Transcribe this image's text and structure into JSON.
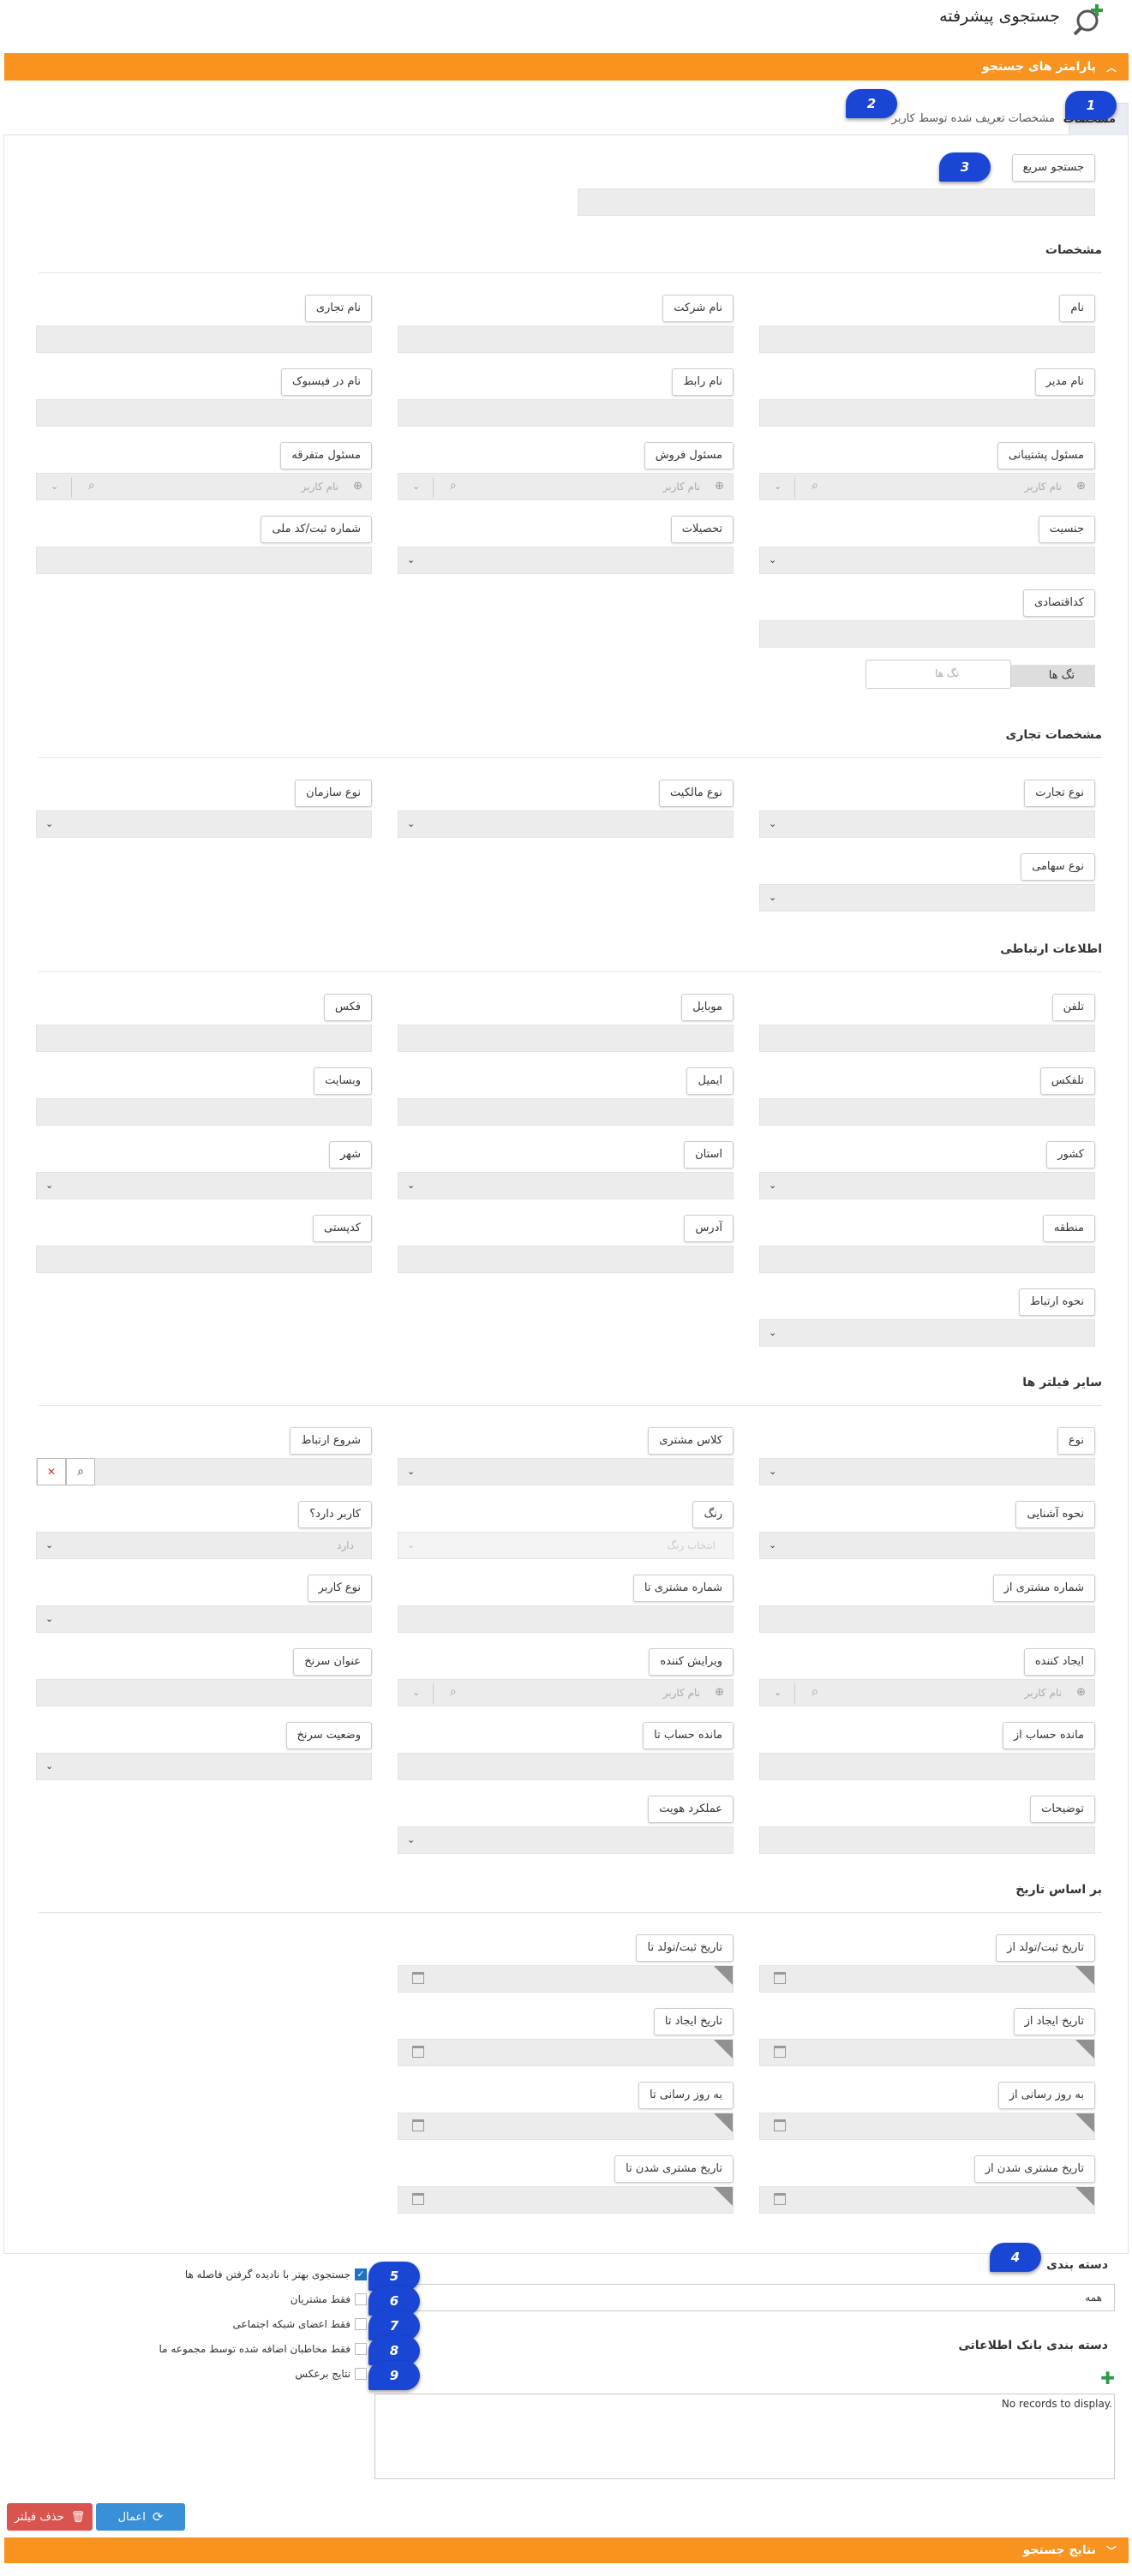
{
  "header": {
    "title": "جستجوی پیشرفته",
    "icon": "search-plus-icon"
  },
  "params_bar": {
    "label": "پارامتر های جستجو"
  },
  "tabs": [
    {
      "label": "مشخصات"
    },
    {
      "label": "مشخصات تعریف شده توسط کاربر"
    }
  ],
  "quick_search": {
    "label": "جستجو سریع"
  },
  "sections": {
    "specs": "مشخصات",
    "business": "مشخصات تجاری",
    "contact": "اطلاعات ارتباطی",
    "other": "سایر فیلتر ها",
    "date": "بر اساس تاریخ"
  },
  "specs": {
    "name": "نام",
    "company": "نام شرکت",
    "brand": "نام تجاری",
    "manager": "نام مدیر",
    "liaison": "نام رابط",
    "facebook": "نام در فیسبوک",
    "support": "مسئول پشتیبانی",
    "sales": "مسئول فروش",
    "misc": "مسئول متفرقه",
    "user_placeholder": "نام کاربر",
    "gender": "جنسیت",
    "education": "تحصیلات",
    "national_id": "شماره ثبت/کد ملی",
    "economic_code": "کداقتصادی",
    "tags_btn": "تگ ها",
    "tags_placeholder": "تگ ها"
  },
  "business": {
    "trade_type": "نوع تجارت",
    "ownership": "نوع مالکیت",
    "org_type": "نوع سازمان",
    "share_type": "نوع سهامی"
  },
  "contact": {
    "phone": "تلفن",
    "mobile": "موبایل",
    "fax": "فکس",
    "telex": "تلفکس",
    "email": "ایمیل",
    "website": "وبسایت",
    "country": "کشور",
    "province": "استان",
    "city": "شهر",
    "region": "منطقه",
    "address": "آدرس",
    "postal": "کدپستی",
    "method": "نحوه ارتباط"
  },
  "other": {
    "type": "نوع",
    "customer_class": "کلاس مشتری",
    "start_contact": "شروع ارتباط",
    "acquaintance": "نحوه آشنایی",
    "color": "رنگ",
    "color_placeholder": "انتخاب رنگ",
    "has_user": "کاربر دارد؟",
    "has_user_value": "دارد",
    "cust_from": "شماره مشتری از",
    "cust_to": "شماره مشتری تا",
    "user_type": "نوع کاربر",
    "creator": "ایجاد کننده",
    "editor": "ویرایش کننده",
    "lead_title": "عنوان سرنخ",
    "bal_from": "مانده حساب از",
    "bal_to": "مانده حساب تا",
    "lead_status": "وضعیت سرنخ",
    "desc": "توضیحات",
    "identity": "عملکرد هویت"
  },
  "date": {
    "reg_from": "تاریخ ثبت/تولد از",
    "reg_to": "تاریخ ثبت/تولد تا",
    "create_from": "تاریخ ایجاد از",
    "create_to": "تاریخ ایجاد تا",
    "upd_from": "به روز رسانی از",
    "upd_to": "به روز رسانی تا",
    "cust_from": "تاریخ مشتری شدن از",
    "cust_to": "تاریخ مشتری شدن تا"
  },
  "grouping": {
    "label": "دسته بندی",
    "value": "همه",
    "db_label": "دسته بندی بانک اطلاعاتی",
    "no_records": "No records to display."
  },
  "options": [
    {
      "label": "جستجوی بهتر با نادیده گرفتن فاصله ها",
      "checked": true
    },
    {
      "label": "فقط مشتریان",
      "checked": false
    },
    {
      "label": "فقط اعضای شبکه اجتماعی",
      "checked": false
    },
    {
      "label": "فقط مخاطبان اضافه شده توسط مجموعه ما",
      "checked": false
    },
    {
      "label": "نتایج برعکس",
      "checked": false
    }
  ],
  "badges": [
    "1",
    "2",
    "3",
    "4",
    "5",
    "6",
    "7",
    "8",
    "9"
  ],
  "buttons": {
    "apply": "اعمال",
    "clear": "حذف فیلتر"
  },
  "results_bar": {
    "label": "نتایج جستجو"
  },
  "colors": {
    "orange": "#f7931e",
    "blue": "#1a46d6",
    "apply": "#3a8fd9",
    "clear": "#d9534f"
  }
}
